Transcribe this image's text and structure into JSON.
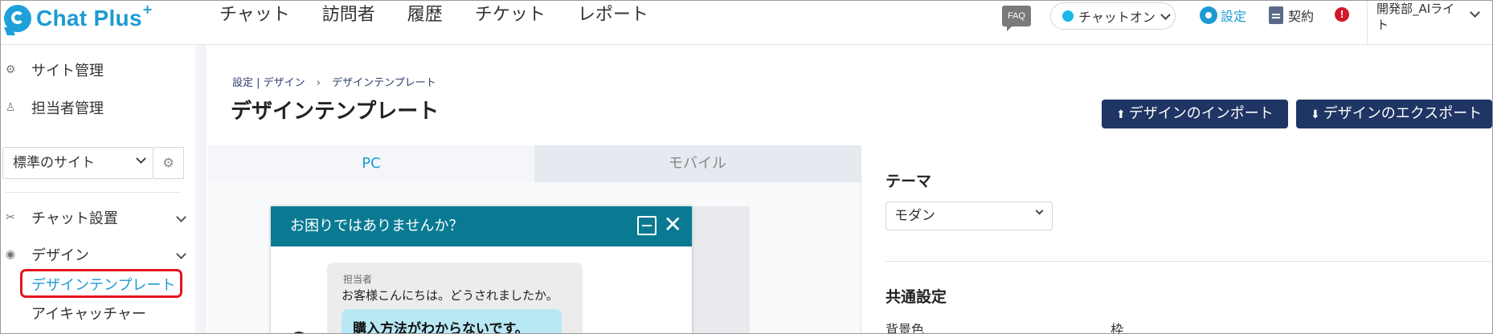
{
  "app": {
    "logo_text": "Chat Plus",
    "logo_sup": "+"
  },
  "nav": [
    "チャット",
    "訪問者",
    "履歴",
    "チケット",
    "レポート"
  ],
  "header": {
    "faq": "FAQ",
    "status": "チャットオン",
    "settings": "設定",
    "contract": "契約",
    "alert": "!",
    "user": "開発部_AIライト"
  },
  "sidebar": {
    "site_mgmt": "サイト管理",
    "staff_mgmt": "担当者管理",
    "site_select": "標準のサイト",
    "chat_install": "チャット設置",
    "design": "デザイン",
    "design_template": "デザインテンプレート",
    "eye_catcher": "アイキャッチャー"
  },
  "main": {
    "breadcrumb": [
      "設定 | デザイン",
      "デザインテンプレート"
    ],
    "breadcrumb_sep": "›",
    "title": "デザインテンプレート",
    "import_btn": "デザインのインポート",
    "export_btn": "デザインのエクスポート",
    "tabs": [
      "PC",
      "モバイル"
    ]
  },
  "preview": {
    "header": "お困りではありませんか？",
    "agent": "担当者",
    "greeting": "お客様こんにちは。どうされましたか。",
    "reply": "購入方法がわからないです。"
  },
  "panel": {
    "theme_label": "テーマ",
    "theme_value": "モダン",
    "common_label": "共通設定",
    "bg_label": "背景色",
    "frame_label": "枠"
  },
  "colors": {
    "brand": "#1c9bd3",
    "button": "#1f3563",
    "chat_header": "#0a7a93",
    "highlight": "#e8131f"
  }
}
